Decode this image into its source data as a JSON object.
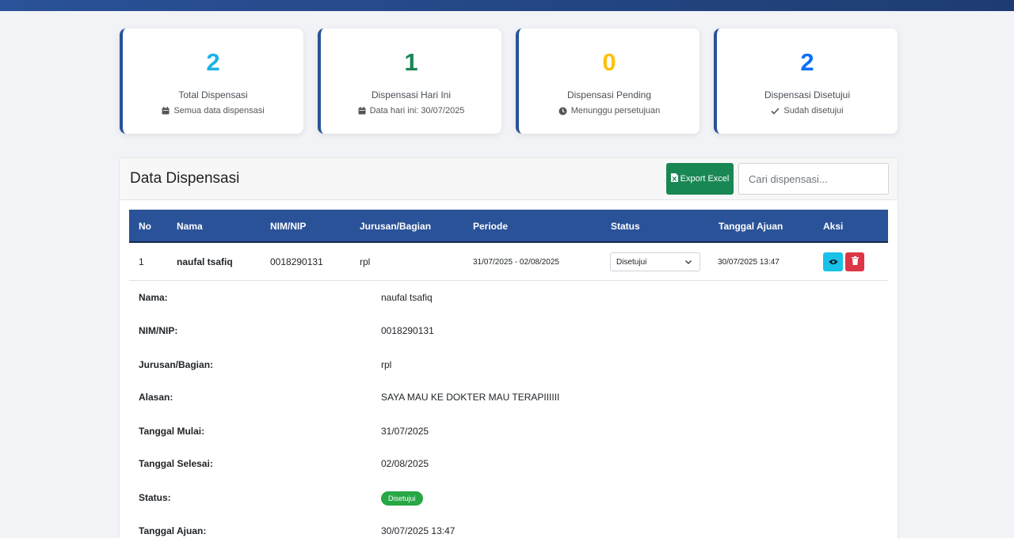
{
  "stats": [
    {
      "value": "2",
      "label": "Total Dispensasi",
      "sub": "Semua data dispensasi",
      "icon": "calendar-icon",
      "color": "#1ab3e6"
    },
    {
      "value": "1",
      "label": "Dispensasi Hari Ini",
      "sub": "Data hari ini: 30/07/2025",
      "icon": "calendar-icon",
      "color": "#198754"
    },
    {
      "value": "0",
      "label": "Dispensasi Pending",
      "sub": "Menunggu persetujuan",
      "icon": "clock-icon",
      "color": "#ffc107"
    },
    {
      "value": "2",
      "label": "Dispensasi Disetujui",
      "sub": "Sudah disetujui",
      "icon": "check-icon",
      "color": "#0d6efd"
    }
  ],
  "panel": {
    "title": "Data Dispensasi",
    "export_label": "Export Excel",
    "search_placeholder": "Cari dispensasi..."
  },
  "table": {
    "headers": [
      "No",
      "Nama",
      "NIM/NIP",
      "Jurusan/Bagian",
      "Periode",
      "Status",
      "Tanggal Ajuan",
      "Aksi"
    ],
    "rows": [
      {
        "no": "1",
        "nama": "naufal tsafiq",
        "nim": "0018290131",
        "jurusan": "rpl",
        "periode": "31/07/2025 - 02/08/2025",
        "status": "Disetujui",
        "tanggal": "30/07/2025 13:47"
      }
    ]
  },
  "detail": {
    "items": [
      {
        "label": "Nama:",
        "value": "naufal tsafiq"
      },
      {
        "label": "NIM/NIP:",
        "value": "0018290131"
      },
      {
        "label": "Jurusan/Bagian:",
        "value": "rpl"
      },
      {
        "label": "Alasan:",
        "value": "SAYA MAU KE DOKTER MAU TERAPIIIIII"
      },
      {
        "label": "Tanggal Mulai:",
        "value": "31/07/2025"
      },
      {
        "label": "Tanggal Selesai:",
        "value": "02/08/2025"
      },
      {
        "label": "Status:",
        "value": "Disetujui"
      },
      {
        "label": "Tanggal Ajuan:",
        "value": "30/07/2025 13:47"
      }
    ]
  },
  "colors": {
    "primary": "#2a5298",
    "success": "#198754",
    "info": "#17c1e8",
    "danger": "#dc3545"
  }
}
